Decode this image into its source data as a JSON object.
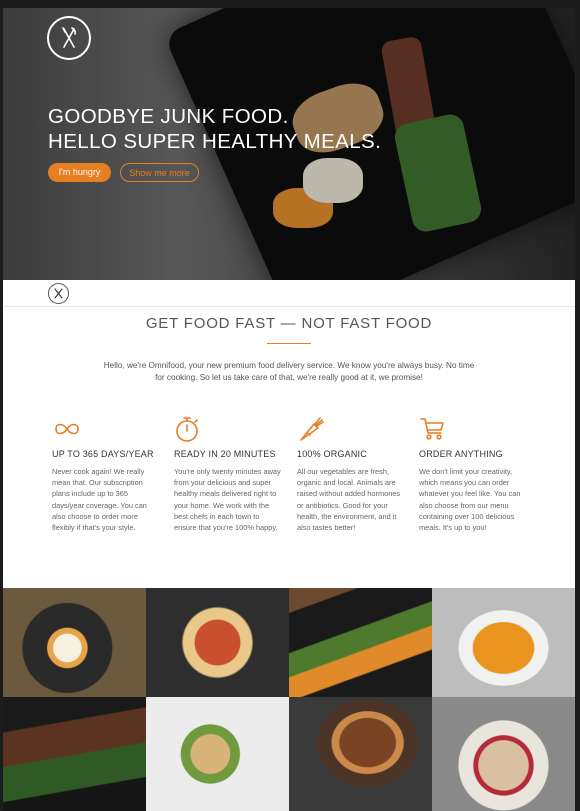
{
  "hero": {
    "headline_line1": "GOODBYE JUNK FOOD.",
    "headline_line2": "HELLO SUPER HEALTHY MEALS.",
    "primary_button": "I'm hungry",
    "secondary_button": "Show me more"
  },
  "features_section": {
    "title": "GET FOOD FAST — NOT FAST FOOD",
    "intro": "Hello, we're Omnifood, your new premium food delivery service. We know you're always busy. No time for cooking. So let us take care of that, we're really good at it, we promise!",
    "items": [
      {
        "icon": "infinity-icon",
        "title": "UP TO 365 DAYS/YEAR",
        "text": "Never cook again! We really mean that. Our subscription plans include up to 365 days/year coverage. You can also choose to order more flexibly if that's your style."
      },
      {
        "icon": "stopwatch-icon",
        "title": "READY IN 20 MINUTES",
        "text": "You're only twenty minutes away from your delicious and super healthy meals delivered right to your home. We work with the best chefs in each town to ensure that you're 100% happy."
      },
      {
        "icon": "carrot-icon",
        "title": "100% ORGANIC",
        "text": "All our vegetables are fresh, organic and local. Animals are raised without added hormones or antibiotics. Good for your health, the environment, and it also tastes better!"
      },
      {
        "icon": "cart-icon",
        "title": "ORDER ANYTHING",
        "text": "We don't limit your creativity, which means you can order whatever you feel like. You can also choose from our menu containing over 100 delicious meals. It's up to you!"
      }
    ]
  },
  "colors": {
    "accent": "#e67e22",
    "text": "#555555"
  },
  "gallery": [
    "bibimbap-photo",
    "pizza-photo",
    "asparagus-plate-photo",
    "pumpkin-soup-photo",
    "steak-photo",
    "sandwich-photo",
    "burger-photo",
    "granola-bowl-photo"
  ]
}
